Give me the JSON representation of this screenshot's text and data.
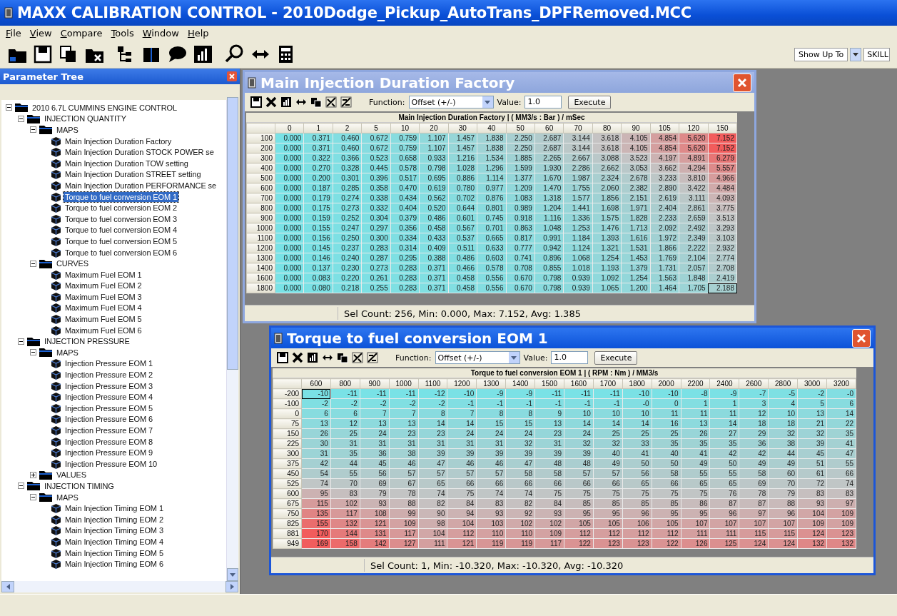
{
  "app": {
    "title": "MAXX CALIBRATION CONTROL - 2010Dodge_Pickup_AutoTrans_DPFRemoved.MCC"
  },
  "menu": [
    "File",
    "View",
    "Compare",
    "Tools",
    "Window",
    "Help"
  ],
  "toolbar": {
    "filter_label": "Show Up To",
    "filter_value": "SKILL"
  },
  "tree": {
    "title": "Parameter Tree",
    "nodes": [
      {
        "label": "2010 6.7L CUMMINS ENGINE CONTROL",
        "kind": "folder",
        "expanded": true,
        "children": [
          {
            "label": "INJECTION QUANTITY",
            "kind": "folder",
            "expanded": true,
            "children": [
              {
                "label": "MAPS",
                "kind": "folder",
                "expanded": true,
                "children": [
                  {
                    "label": "Main Injection Duration Factory",
                    "kind": "map",
                    "selected": false
                  },
                  {
                    "label": "Main Injection Duration STOCK POWER se",
                    "kind": "map",
                    "selected": false
                  },
                  {
                    "label": "Main Injection Duration TOW setting",
                    "kind": "map",
                    "selected": false
                  },
                  {
                    "label": "Main Injection Duration STREET setting",
                    "kind": "map",
                    "selected": false
                  },
                  {
                    "label": "Main Injection Duration PERFORMANCE se",
                    "kind": "map",
                    "selected": false
                  },
                  {
                    "label": "Torque to fuel conversion EOM 1",
                    "kind": "map",
                    "selected": true
                  },
                  {
                    "label": "Torque to fuel conversion EOM 2",
                    "kind": "map",
                    "selected": false
                  },
                  {
                    "label": "Torque to fuel conversion EOM 3",
                    "kind": "map",
                    "selected": false
                  },
                  {
                    "label": "Torque to fuel conversion EOM 4",
                    "kind": "map",
                    "selected": false
                  },
                  {
                    "label": "Torque to fuel conversion EOM 5",
                    "kind": "map",
                    "selected": false
                  },
                  {
                    "label": "Torque to fuel conversion EOM 6",
                    "kind": "map",
                    "selected": false
                  }
                ]
              },
              {
                "label": "CURVES",
                "kind": "folder",
                "expanded": true,
                "children": [
                  {
                    "label": "Maximum Fuel EOM 1",
                    "kind": "map",
                    "selected": false
                  },
                  {
                    "label": "Maximum Fuel EOM 2",
                    "kind": "map",
                    "selected": false
                  },
                  {
                    "label": "Maximum Fuel EOM 3",
                    "kind": "map",
                    "selected": false
                  },
                  {
                    "label": "Maximum Fuel EOM 4",
                    "kind": "map",
                    "selected": false
                  },
                  {
                    "label": "Maximum Fuel EOM 5",
                    "kind": "map",
                    "selected": false
                  },
                  {
                    "label": "Maximum Fuel EOM 6",
                    "kind": "map",
                    "selected": false
                  }
                ]
              }
            ]
          },
          {
            "label": "INJECTION PRESSURE",
            "kind": "folder",
            "expanded": true,
            "children": [
              {
                "label": "MAPS",
                "kind": "folder",
                "expanded": true,
                "children": [
                  {
                    "label": "Injection Pressure EOM 1",
                    "kind": "map",
                    "selected": false
                  },
                  {
                    "label": "Injection Pressure EOM 2",
                    "kind": "map",
                    "selected": false
                  },
                  {
                    "label": "Injection Pressure EOM 3",
                    "kind": "map",
                    "selected": false
                  },
                  {
                    "label": "Injection Pressure EOM 4",
                    "kind": "map",
                    "selected": false
                  },
                  {
                    "label": "Injection Pressure EOM 5",
                    "kind": "map",
                    "selected": false
                  },
                  {
                    "label": "Injection Pressure EOM 6",
                    "kind": "map",
                    "selected": false
                  },
                  {
                    "label": "Injection Pressure EOM 7",
                    "kind": "map",
                    "selected": false
                  },
                  {
                    "label": "Injection Pressure EOM 8",
                    "kind": "map",
                    "selected": false
                  },
                  {
                    "label": "Injection Pressure EOM 9",
                    "kind": "map",
                    "selected": false
                  },
                  {
                    "label": "Injection Pressure EOM 10",
                    "kind": "map",
                    "selected": false
                  }
                ]
              },
              {
                "label": "VALUES",
                "kind": "folder",
                "expanded": false
              }
            ]
          },
          {
            "label": "INJECTION TIMING",
            "kind": "folder",
            "expanded": true,
            "children": [
              {
                "label": "MAPS",
                "kind": "folder",
                "expanded": true,
                "children": [
                  {
                    "label": "Main Injection Timing EOM 1",
                    "kind": "map",
                    "selected": false
                  },
                  {
                    "label": "Main Injection Timing EOM 2",
                    "kind": "map",
                    "selected": false
                  },
                  {
                    "label": "Main Injection Timing EOM 3",
                    "kind": "map",
                    "selected": false
                  },
                  {
                    "label": "Main Injection Timing EOM 4",
                    "kind": "map",
                    "selected": false
                  },
                  {
                    "label": "Main Injection Timing EOM 5",
                    "kind": "map",
                    "selected": false
                  },
                  {
                    "label": "Main Injection Timing EOM 6",
                    "kind": "map",
                    "selected": false
                  }
                ]
              }
            ]
          }
        ]
      }
    ]
  },
  "windows": [
    {
      "title": "Main Injection Duration Factory",
      "active": false,
      "function_label": "Function:",
      "function_value": "Offset (+/-)",
      "value_label": "Value:",
      "value": "1.0",
      "execute": "Execute",
      "table_title": "Main Injection Duration Factory |  ( MM3/s : Bar ) / mSec",
      "columns": [
        "0",
        "1",
        "2",
        "5",
        "10",
        "20",
        "30",
        "40",
        "50",
        "60",
        "70",
        "80",
        "90",
        "105",
        "120",
        "150"
      ],
      "rows": [
        {
          "label": "100",
          "cells": [
            "0.000",
            "0.371",
            "0.460",
            "0.672",
            "0.759",
            "1.107",
            "1.457",
            "1.838",
            "2.250",
            "2.687",
            "3.144",
            "3.618",
            "4.105",
            "4.854",
            "5.620",
            "7.152"
          ]
        },
        {
          "label": "200",
          "cells": [
            "0.000",
            "0.371",
            "0.460",
            "0.672",
            "0.759",
            "1.107",
            "1.457",
            "1.838",
            "2.250",
            "2.687",
            "3.144",
            "3.618",
            "4.105",
            "4.854",
            "5.620",
            "7.152"
          ]
        },
        {
          "label": "300",
          "cells": [
            "0.000",
            "0.322",
            "0.366",
            "0.523",
            "0.658",
            "0.933",
            "1.216",
            "1.534",
            "1.885",
            "2.265",
            "2.667",
            "3.088",
            "3.523",
            "4.197",
            "4.891",
            "6.279"
          ]
        },
        {
          "label": "400",
          "cells": [
            "0.000",
            "0.270",
            "0.328",
            "0.445",
            "0.578",
            "0.798",
            "1.028",
            "1.296",
            "1.599",
            "1.930",
            "2.286",
            "2.662",
            "3.053",
            "3.662",
            "4.294",
            "5.557"
          ]
        },
        {
          "label": "500",
          "cells": [
            "0.000",
            "0.200",
            "0.301",
            "0.396",
            "0.517",
            "0.695",
            "0.886",
            "1.114",
            "1.377",
            "1.670",
            "1.987",
            "2.324",
            "2.678",
            "3.233",
            "3.810",
            "4.966"
          ]
        },
        {
          "label": "600",
          "cells": [
            "0.000",
            "0.187",
            "0.285",
            "0.358",
            "0.470",
            "0.619",
            "0.780",
            "0.977",
            "1.209",
            "1.470",
            "1.755",
            "2.060",
            "2.382",
            "2.890",
            "3.422",
            "4.484"
          ]
        },
        {
          "label": "700",
          "cells": [
            "0.000",
            "0.179",
            "0.274",
            "0.338",
            "0.434",
            "0.562",
            "0.702",
            "0.876",
            "1.083",
            "1.318",
            "1.577",
            "1.856",
            "2.151",
            "2.619",
            "3.111",
            "4.093"
          ]
        },
        {
          "label": "800",
          "cells": [
            "0.000",
            "0.175",
            "0.273",
            "0.332",
            "0.404",
            "0.520",
            "0.644",
            "0.801",
            "0.989",
            "1.204",
            "1.441",
            "1.698",
            "1.971",
            "2.404",
            "2.861",
            "3.775"
          ]
        },
        {
          "label": "900",
          "cells": [
            "0.000",
            "0.159",
            "0.252",
            "0.304",
            "0.379",
            "0.486",
            "0.601",
            "0.745",
            "0.918",
            "1.116",
            "1.336",
            "1.575",
            "1.828",
            "2.233",
            "2.659",
            "3.513"
          ]
        },
        {
          "label": "1000",
          "cells": [
            "0.000",
            "0.155",
            "0.247",
            "0.297",
            "0.356",
            "0.458",
            "0.567",
            "0.701",
            "0.863",
            "1.048",
            "1.253",
            "1.476",
            "1.713",
            "2.092",
            "2.492",
            "3.293"
          ]
        },
        {
          "label": "1100",
          "cells": [
            "0.000",
            "0.156",
            "0.250",
            "0.300",
            "0.334",
            "0.433",
            "0.537",
            "0.665",
            "0.817",
            "0.991",
            "1.184",
            "1.393",
            "1.616",
            "1.972",
            "2.349",
            "3.103"
          ]
        },
        {
          "label": "1200",
          "cells": [
            "0.000",
            "0.145",
            "0.237",
            "0.283",
            "0.314",
            "0.409",
            "0.511",
            "0.633",
            "0.777",
            "0.942",
            "1.124",
            "1.321",
            "1.531",
            "1.866",
            "2.222",
            "2.932"
          ]
        },
        {
          "label": "1300",
          "cells": [
            "0.000",
            "0.146",
            "0.240",
            "0.287",
            "0.295",
            "0.388",
            "0.486",
            "0.603",
            "0.741",
            "0.896",
            "1.068",
            "1.254",
            "1.453",
            "1.769",
            "2.104",
            "2.774"
          ]
        },
        {
          "label": "1400",
          "cells": [
            "0.000",
            "0.137",
            "0.230",
            "0.273",
            "0.283",
            "0.371",
            "0.466",
            "0.578",
            "0.708",
            "0.855",
            "1.018",
            "1.193",
            "1.379",
            "1.731",
            "2.057",
            "2.708"
          ]
        },
        {
          "label": "1600",
          "cells": [
            "0.000",
            "0.083",
            "0.220",
            "0.261",
            "0.283",
            "0.371",
            "0.458",
            "0.556",
            "0.670",
            "0.798",
            "0.939",
            "1.092",
            "1.254",
            "1.563",
            "1.848",
            "2.419"
          ]
        },
        {
          "label": "1800",
          "cells": [
            "0.000",
            "0.080",
            "0.218",
            "0.255",
            "0.283",
            "0.371",
            "0.458",
            "0.556",
            "0.670",
            "0.798",
            "0.939",
            "1.065",
            "1.200",
            "1.464",
            "1.705",
            {
              "value": "2.188",
              "selected": true
            }
          ]
        }
      ],
      "status": "Sel Count: 256, Min: 0.000, Max: 7.152, Avg: 1.385"
    },
    {
      "title": "Torque to fuel conversion EOM 1",
      "active": true,
      "function_label": "Function:",
      "function_value": "Offset (+/-)",
      "value_label": "Value:",
      "value": "1.0",
      "execute": "Execute",
      "table_title": "Torque to fuel conversion EOM 1 |  ( RPM : Nm ) / MM3/s",
      "columns": [
        "600",
        "800",
        "900",
        "1000",
        "1100",
        "1200",
        "1300",
        "1400",
        "1500",
        "1600",
        "1700",
        "1800",
        "2000",
        "2200",
        "2400",
        "2600",
        "2800",
        "3000",
        "3200"
      ],
      "rows": [
        {
          "label": "-200",
          "cells": [
            {
              "value": "-10",
              "selected": true
            },
            "-11",
            "-11",
            "-11",
            "-12",
            "-10",
            "-9",
            "-9",
            "-11",
            "-11",
            "-11",
            "-10",
            "-10",
            "-8",
            "-9",
            "-7",
            "-5",
            "-2",
            "-0"
          ]
        },
        {
          "label": "-100",
          "cells": [
            "-2",
            "-2",
            "-2",
            "-2",
            "-2",
            "-1",
            "-1",
            "-1",
            "-1",
            "-1",
            "-1",
            "-0",
            "0",
            "1",
            "1",
            "3",
            "4",
            "5",
            "6"
          ]
        },
        {
          "label": "0",
          "cells": [
            "6",
            "6",
            "7",
            "7",
            "8",
            "7",
            "8",
            "8",
            "9",
            "10",
            "10",
            "10",
            "11",
            "11",
            "11",
            "12",
            "10",
            "13",
            "14"
          ]
        },
        {
          "label": "75",
          "cells": [
            "13",
            "12",
            "13",
            "13",
            "14",
            "14",
            "15",
            "15",
            "13",
            "14",
            "14",
            "14",
            "16",
            "13",
            "14",
            "18",
            "18",
            "21",
            "22"
          ]
        },
        {
          "label": "150",
          "cells": [
            "26",
            "25",
            "24",
            "23",
            "23",
            "24",
            "24",
            "24",
            "23",
            "24",
            "25",
            "25",
            "25",
            "26",
            "27",
            "29",
            "32",
            "32",
            "35"
          ]
        },
        {
          "label": "225",
          "cells": [
            "30",
            "31",
            "31",
            "31",
            "31",
            "31",
            "31",
            "32",
            "31",
            "32",
            "32",
            "33",
            "35",
            "35",
            "35",
            "36",
            "38",
            "39",
            "41"
          ]
        },
        {
          "label": "300",
          "cells": [
            "31",
            "35",
            "36",
            "38",
            "39",
            "39",
            "39",
            "39",
            "39",
            "39",
            "40",
            "41",
            "40",
            "41",
            "42",
            "42",
            "44",
            "45",
            "47"
          ]
        },
        {
          "label": "375",
          "cells": [
            "42",
            "44",
            "45",
            "46",
            "47",
            "46",
            "46",
            "47",
            "48",
            "48",
            "49",
            "50",
            "50",
            "49",
            "50",
            "49",
            "49",
            "51",
            "55"
          ]
        },
        {
          "label": "450",
          "cells": [
            "54",
            "55",
            "56",
            "57",
            "57",
            "57",
            "57",
            "58",
            "58",
            "57",
            "57",
            "56",
            "58",
            "55",
            "55",
            "58",
            "60",
            "61",
            "66"
          ]
        },
        {
          "label": "525",
          "cells": [
            "74",
            "70",
            "69",
            "67",
            "65",
            "66",
            "66",
            "66",
            "66",
            "66",
            "66",
            "65",
            "66",
            "65",
            "65",
            "69",
            "70",
            "72",
            "74"
          ]
        },
        {
          "label": "600",
          "cells": [
            "95",
            "83",
            "79",
            "78",
            "74",
            "75",
            "74",
            "74",
            "75",
            "75",
            "75",
            "75",
            "75",
            "75",
            "76",
            "78",
            "79",
            "83",
            "83"
          ]
        },
        {
          "label": "675",
          "cells": [
            "115",
            "102",
            "93",
            "88",
            "82",
            "84",
            "83",
            "82",
            "84",
            "85",
            "85",
            "85",
            "85",
            "86",
            "87",
            "87",
            "88",
            "93",
            "97"
          ]
        },
        {
          "label": "750",
          "cells": [
            "135",
            "117",
            "108",
            "99",
            "90",
            "94",
            "93",
            "92",
            "93",
            "95",
            "95",
            "96",
            "95",
            "95",
            "96",
            "97",
            "96",
            "104",
            "109"
          ]
        },
        {
          "label": "825",
          "cells": [
            "155",
            "132",
            "121",
            "109",
            "98",
            "104",
            "103",
            "102",
            "102",
            "105",
            "105",
            "106",
            "105",
            "107",
            "107",
            "107",
            "107",
            "109",
            "109"
          ]
        },
        {
          "label": "881",
          "cells": [
            "170",
            "144",
            "131",
            "117",
            "104",
            "112",
            "110",
            "110",
            "109",
            "112",
            "112",
            "112",
            "112",
            "111",
            "111",
            "115",
            "115",
            "124",
            "123"
          ]
        },
        {
          "label": "949",
          "cells": [
            "169",
            "158",
            "142",
            "127",
            "111",
            "121",
            "119",
            "119",
            "117",
            "122",
            "123",
            "123",
            "122",
            "126",
            "125",
            "124",
            "124",
            "132",
            "132"
          ]
        }
      ],
      "status": "Sel Count: 1, Min: -10.320, Max: -10.320, Avg: -10.320"
    }
  ]
}
